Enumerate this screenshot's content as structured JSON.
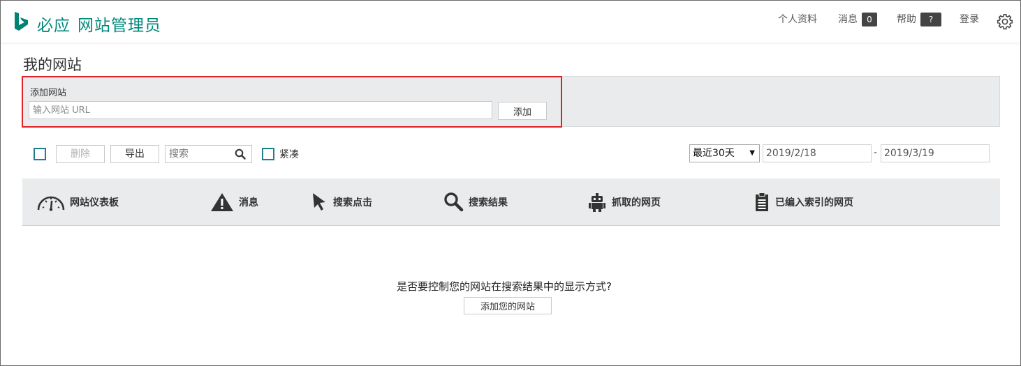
{
  "header": {
    "brand_main": "必应",
    "brand_sub": "网站管理员",
    "nav": {
      "profile": "个人资料",
      "messages": "消息",
      "messages_count": "0",
      "help": "帮助",
      "help_badge": "?",
      "login": "登录"
    }
  },
  "page": {
    "title": "我的网站"
  },
  "add_site": {
    "label": "添加网站",
    "placeholder": "输入网站 URL",
    "button": "添加"
  },
  "toolbar": {
    "delete": "删除",
    "export": "导出",
    "search_placeholder": "搜索",
    "compact": "紧凑",
    "range": "最近30天",
    "date_from": "2019/2/18",
    "date_sep": "-",
    "date_to": "2019/3/19"
  },
  "tabs": [
    {
      "label": "网站仪表板",
      "icon": "dashboard-gauge-icon"
    },
    {
      "label": "消息",
      "icon": "warning-icon"
    },
    {
      "label": "搜索点击",
      "icon": "cursor-pointer-icon"
    },
    {
      "label": "搜索结果",
      "icon": "magnifier-icon"
    },
    {
      "label": "抓取的网页",
      "icon": "robot-icon"
    },
    {
      "label": "已编入索引的网页",
      "icon": "clipboard-icon"
    }
  ],
  "empty_state": {
    "text": "是否要控制您的网站在搜索结果中的显示方式?",
    "button": "添加您的网站"
  },
  "colors": {
    "brand": "#00897b",
    "checkbox": "#1f7d8c",
    "highlight": "#e0212a"
  }
}
